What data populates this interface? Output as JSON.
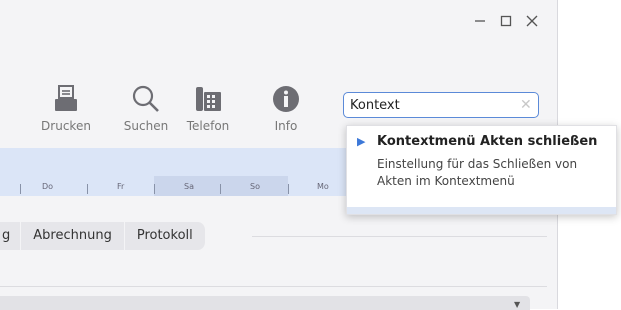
{
  "window": {
    "minimize_icon": "minimize-icon",
    "maximize_icon": "maximize-icon",
    "close_icon": "close-icon"
  },
  "toolbar": {
    "items": [
      {
        "label": "Drucken",
        "icon": "printer-icon"
      },
      {
        "label": "Suchen",
        "icon": "search-icon"
      },
      {
        "label": "Telefon",
        "icon": "telephone-icon"
      },
      {
        "label": "Info",
        "icon": "info-icon"
      }
    ]
  },
  "search": {
    "value": "Kontext",
    "clear_icon": "clear-icon"
  },
  "dropdown": {
    "title": "Kontextmenü Akten schließen",
    "description": "Einstellung für das Schließen von Akten im Kontextmenü"
  },
  "calendar": {
    "days": [
      "Do",
      "Fr",
      "Sa",
      "So",
      "Mo"
    ]
  },
  "tabs": [
    "g",
    "Abrechnung",
    "Protokoll"
  ],
  "colors": {
    "accent": "#5b8ad8",
    "calendar_bg": "#dbe5f7",
    "weekend_bg": "#cbd6ec"
  }
}
